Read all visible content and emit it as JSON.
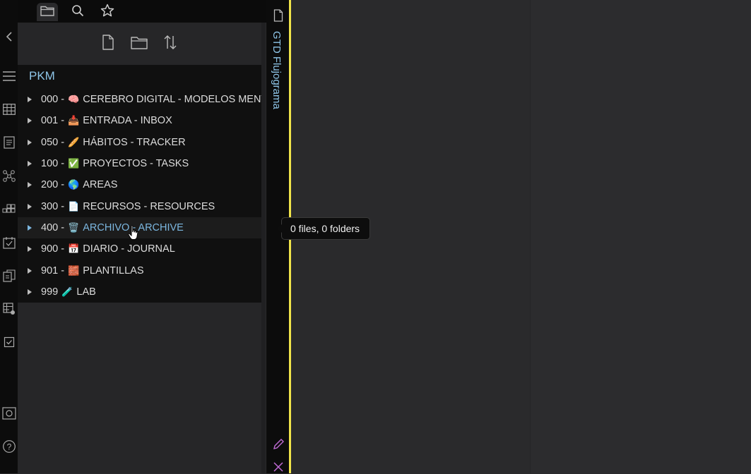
{
  "sidebar_tabs": [
    {
      "label": "Files",
      "icon": "folder-icon"
    },
    {
      "label": "Search",
      "icon": "search-icon"
    },
    {
      "label": "Bookmarks",
      "icon": "star-icon"
    }
  ],
  "toolbar": {
    "new_note": "New note",
    "new_folder": "New folder",
    "sort": "Change sort order"
  },
  "vault_name": "PKM",
  "folders": [
    {
      "num": "000 -",
      "emoji": "🧠",
      "name": "CEREBRO DIGITAL - MODELOS MENT"
    },
    {
      "num": "001 -",
      "emoji": "📥",
      "name": "ENTRADA - INBOX"
    },
    {
      "num": "050 -",
      "emoji": "🥖",
      "name": "HÁBITOS - TRACKER"
    },
    {
      "num": "100 -",
      "emoji": "✅",
      "name": "PROYECTOS - TASKS"
    },
    {
      "num": "200 -",
      "emoji": "🌎",
      "name": "AREAS"
    },
    {
      "num": "300 -",
      "emoji": "📄",
      "name": "RECURSOS - RESOURCES"
    },
    {
      "num": "400 -",
      "emoji": "🗑️",
      "name": "ARCHIVO - ARCHIVE",
      "hover": true
    },
    {
      "num": "900 -",
      "emoji": "📅",
      "name": "DIARIO - JOURNAL"
    },
    {
      "num": "901 -",
      "emoji": "🧱",
      "name": "PLANTILLAS"
    },
    {
      "num": "999",
      "emoji": "🧪",
      "name": "LAB"
    }
  ],
  "tooltip": "0 files, 0 folders",
  "vertical_tab_title": "GTD Flujograma",
  "colors": {
    "accent": "#8ec5e8",
    "highlight_line": "#f0e44a",
    "background": "#2a2a2c"
  }
}
